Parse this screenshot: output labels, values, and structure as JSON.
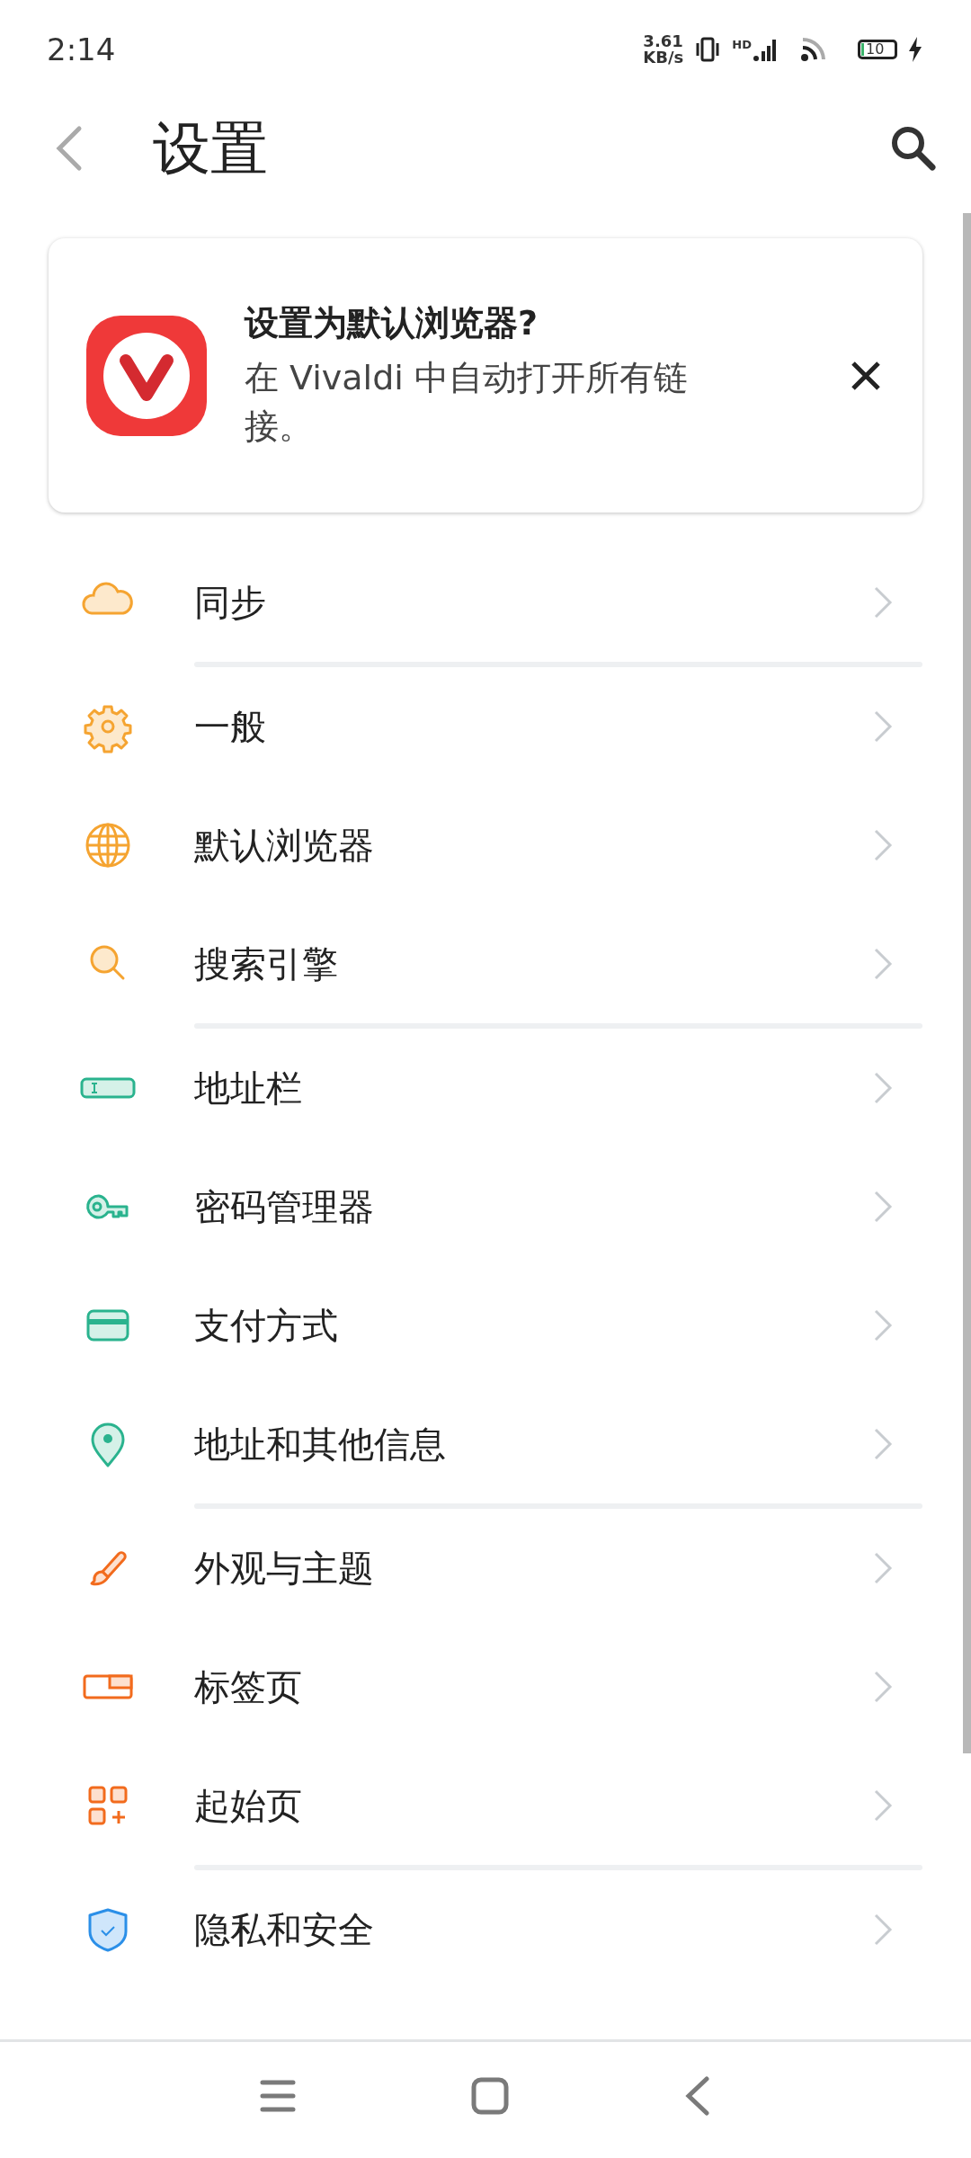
{
  "status_bar": {
    "time": "2:14",
    "net_speed": "3.61",
    "net_unit": "KB/s",
    "signal_label": "HD",
    "battery": "10"
  },
  "header": {
    "title": "设置"
  },
  "promo": {
    "title": "设置为默认浏览器?",
    "text": "在 Vivaldi 中自动打开所有链接。"
  },
  "groups": [
    {
      "items": [
        {
          "label": "同步",
          "kind": "cloud"
        }
      ]
    },
    {
      "items": [
        {
          "label": "一般",
          "kind": "gear"
        },
        {
          "label": "默认浏览器",
          "kind": "globe"
        },
        {
          "label": "搜索引擎",
          "kind": "search"
        }
      ]
    },
    {
      "items": [
        {
          "label": "地址栏",
          "kind": "addressbar"
        },
        {
          "label": "密码管理器",
          "kind": "key"
        },
        {
          "label": "支付方式",
          "kind": "card"
        },
        {
          "label": "地址和其他信息",
          "kind": "pin"
        }
      ]
    },
    {
      "items": [
        {
          "label": "外观与主题",
          "kind": "brush"
        },
        {
          "label": "标签页",
          "kind": "tabs"
        },
        {
          "label": "起始页",
          "kind": "grid"
        }
      ]
    },
    {
      "items": [
        {
          "label": "隐私和安全",
          "kind": "shield"
        }
      ]
    }
  ]
}
